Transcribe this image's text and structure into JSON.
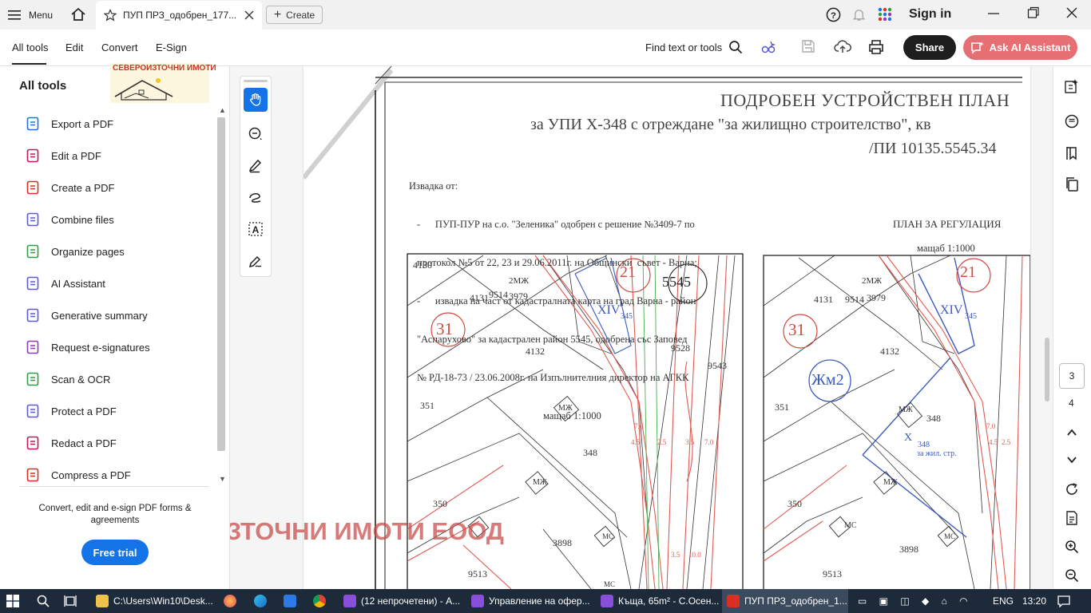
{
  "titlebar": {
    "menu_label": "Menu",
    "tab_title": "ПУП ПРЗ_одобрен_177...",
    "create_label": "Create",
    "sign_in": "Sign in"
  },
  "toolbar": {
    "tabs": [
      "All tools",
      "Edit",
      "Convert",
      "E-Sign"
    ],
    "find_label": "Find text or tools",
    "share_label": "Share",
    "ask_ai_label": "Ask AI Assistant"
  },
  "left_panel": {
    "title": "All tools",
    "logo_text": "СЕВЕРОИЗТОЧНИ ИМОТИ",
    "tools": [
      {
        "label": "Export a PDF",
        "color": "#1a73e8"
      },
      {
        "label": "Edit a PDF",
        "color": "#c2185b"
      },
      {
        "label": "Create a PDF",
        "color": "#d93025"
      },
      {
        "label": "Combine files",
        "color": "#5b5bd6"
      },
      {
        "label": "Organize pages",
        "color": "#2e9d48"
      },
      {
        "label": "AI Assistant",
        "color": "#5b5bd6"
      },
      {
        "label": "Generative summary",
        "color": "#5b5bd6"
      },
      {
        "label": "Request e-signatures",
        "color": "#8e3ab8"
      },
      {
        "label": "Scan & OCR",
        "color": "#2e9d48"
      },
      {
        "label": "Protect a PDF",
        "color": "#5b5bd6"
      },
      {
        "label": "Redact a PDF",
        "color": "#c2185b"
      },
      {
        "label": "Compress a PDF",
        "color": "#d93025"
      }
    ],
    "promo_text": "Convert, edit and e-sign PDF forms & agreements",
    "free_trial": "Free trial"
  },
  "document": {
    "title_line1": "ПОДРОБЕН УСТРОЙСТВЕН ПЛАН",
    "title_line2": "за УПИ Х-348 с отреждане \"за жилищно строителство\", кв",
    "title_line3": "/ПИ 10135.5545.34",
    "excerpt": [
      "Извадка от:",
      "-      ПУП-ПУР на с.о. \"Зеленика\" одобрен с решение №3409-7 по",
      "протокол №5 от 22, 23 и 29.06.2011г. на Общински  съвет - Варна;",
      "-      извадка на част от кадастралната карта на град Варна - район",
      "\"Аспарухово\" за кадастрален район 5545, одобрена със Заповед",
      "№ РД-18-73 / 23.06.2008г. на Изпълнителния директор на АГКК",
      "мащаб 1:1000"
    ],
    "plan_label": "ПЛАН ЗА РЕГУЛАЦИЯ",
    "plan_scale": "мащаб 1:1000",
    "watermark": "СЕВЕРОИЗТОЧНИ ИМОТИ ЕООД",
    "map_left": {
      "labels": [
        "4130",
        "4131",
        "31",
        "9514",
        "3979",
        "2МЖ",
        "21",
        "XIV",
        "345",
        "5545",
        "4132",
        "9528",
        "9543",
        "351",
        "МЖ",
        "348",
        "350",
        "МЖ",
        "3898",
        "МС",
        "9513",
        "МС",
        "7.0",
        "4.5",
        "2.5",
        "3.5",
        "7.0",
        "3.5",
        "10.0"
      ]
    },
    "map_right": {
      "labels": [
        "4131",
        "31",
        "9514",
        "3979",
        "2МЖ",
        "21",
        "XIV",
        "345",
        "4132",
        "Жм2",
        "351",
        "МЖ",
        "348",
        "X",
        "348",
        "за жил. стр.",
        "350",
        "МЖ",
        "МС",
        "3898",
        "МС",
        "9513",
        "7.0",
        "2.5",
        "4.5"
      ]
    }
  },
  "right_rail": {
    "page_current": "3",
    "page_next": "4"
  },
  "taskbar": {
    "items": [
      "C:\\Users\\Win10\\Desk...",
      "(12 непрочетени) - А...",
      "Управление на офер...",
      "Къща, 65m² - С.Осен...",
      "ПУП ПРЗ_одобрен_1..."
    ],
    "lang": "ENG",
    "time": "13:20"
  }
}
